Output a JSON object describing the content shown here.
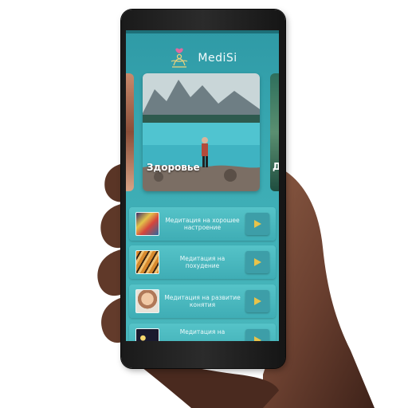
{
  "app": {
    "title": "MediSi",
    "logo_icon": "lotus-meditation-icon"
  },
  "carousel": {
    "active_card": {
      "label": "Здоровье",
      "image": "mountain-lake-hiker-photo"
    },
    "next_card": {
      "label": "Д",
      "image": "forest-photo"
    },
    "prev_card": {
      "image": "portrait-photo"
    }
  },
  "meditations": [
    {
      "title": "Медитация на хорошее настроение",
      "thumb": "colorful-abstract-thumb",
      "play_icon": "play-icon"
    },
    {
      "title": "Медитация на похудение",
      "thumb": "tiger-thumb",
      "play_icon": "play-icon"
    },
    {
      "title": "Медитация на развитие конятия",
      "thumb": "child-portrait-thumb",
      "play_icon": "play-icon"
    },
    {
      "title": "Медитация на",
      "thumb": "night-lights-thumb",
      "play_icon": "play-icon"
    }
  ],
  "colors": {
    "accent": "#3aaab3",
    "play_triangle": "#e8c34a",
    "list_item": "#4bb9be"
  }
}
